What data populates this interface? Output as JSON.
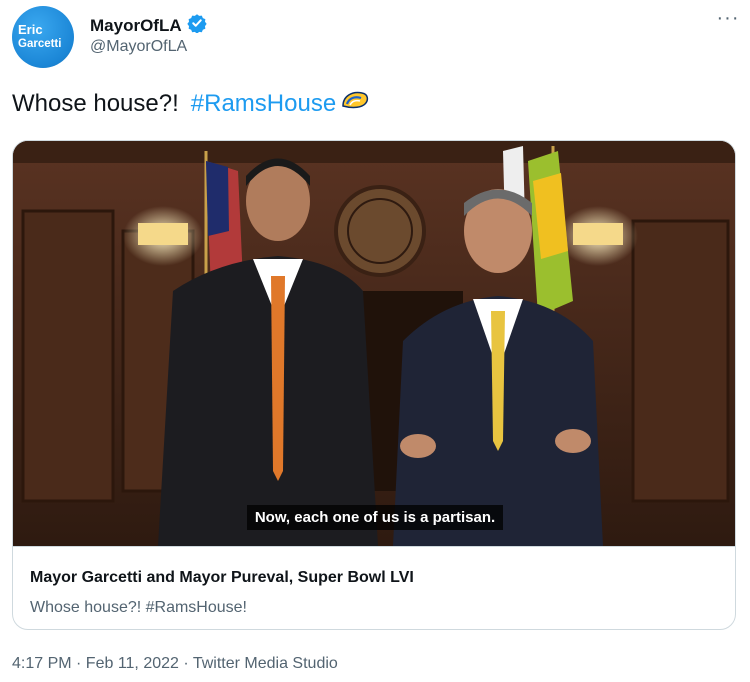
{
  "author": {
    "avatar_line1": "Eric",
    "avatar_line2": "Garcetti",
    "display_name": "MayorOfLA",
    "handle": "@MayorOfLA",
    "verified": true
  },
  "tweet": {
    "text": "Whose house?!",
    "hashtag": "#RamsHouse"
  },
  "card": {
    "caption": "Now, each one of us is a partisan.",
    "title": "Mayor Garcetti and Mayor Pureval, Super Bowl LVI",
    "description": "Whose house?!  #RamsHouse!"
  },
  "footer": {
    "meta": "4:17 PM · Feb 11, 2022 · Twitter Media Studio"
  },
  "colors": {
    "accent": "#1d9bf0",
    "secondary_text": "#536471",
    "border": "#cfd9de"
  },
  "icons": [
    "verified-badge-icon",
    "more-options-icon",
    "rams-hashflag-icon"
  ]
}
